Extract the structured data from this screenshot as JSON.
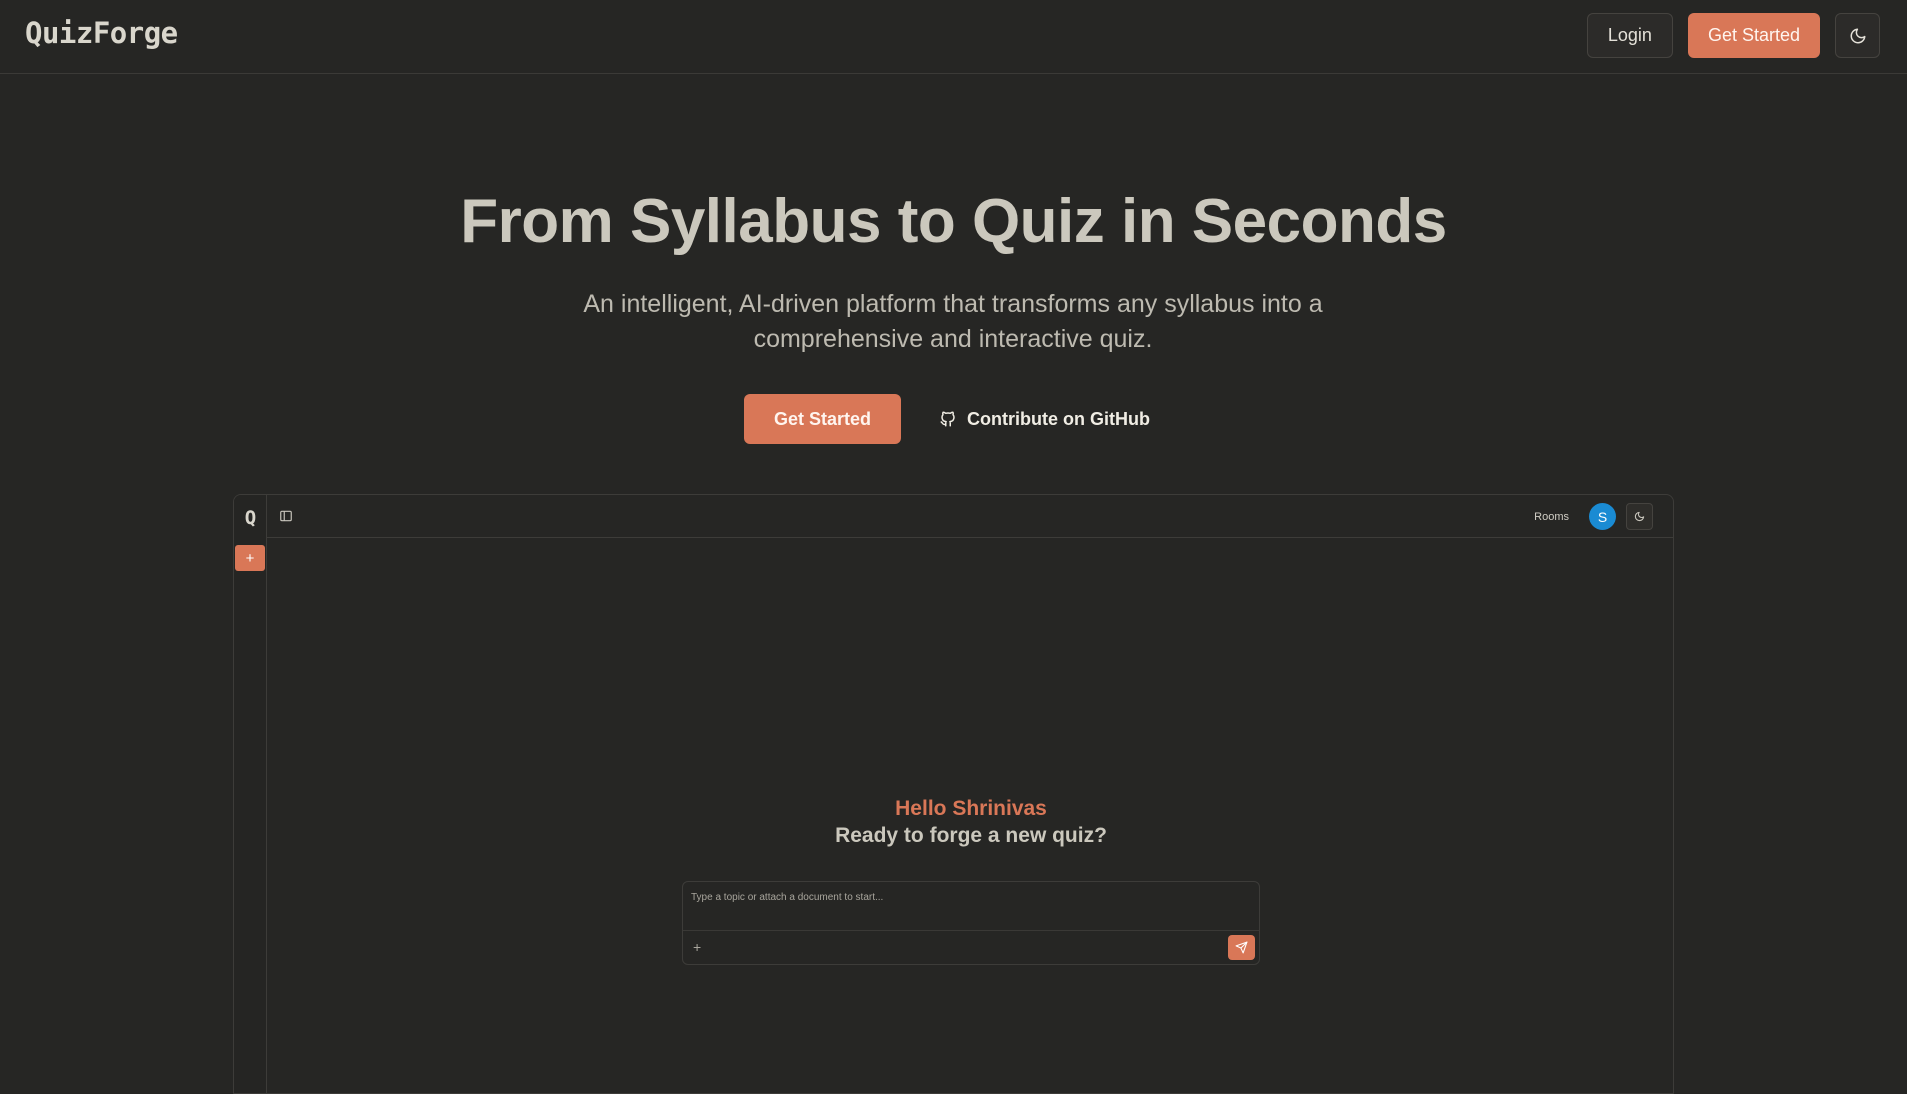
{
  "nav": {
    "brand": "QuizForge",
    "login_label": "Login",
    "get_started_label": "Get Started",
    "theme_icon": "moon-icon"
  },
  "hero": {
    "title": "From Syllabus to Quiz in Seconds",
    "subtitle": "An intelligent, AI-driven platform that transforms any syllabus into a comprehensive and interactive quiz.",
    "cta_label": "Get Started",
    "github_label": "Contribute on GitHub",
    "github_icon": "github-icon"
  },
  "preview": {
    "logo": "Q",
    "new_button": "+",
    "rooms_label": "Rooms",
    "avatar_initial": "S",
    "greeting": "Hello Shrinivas",
    "prompt": "Ready to forge a new quiz?",
    "input_placeholder": "Type a topic or attach a document to start...",
    "attach_label": "+",
    "icons": [
      "sidebar-toggle-icon",
      "moon-icon",
      "send-icon"
    ]
  },
  "colors": {
    "background": "#262624",
    "accent": "#d97757",
    "avatar": "#1a8bd3",
    "text": "#cbc8bd"
  }
}
